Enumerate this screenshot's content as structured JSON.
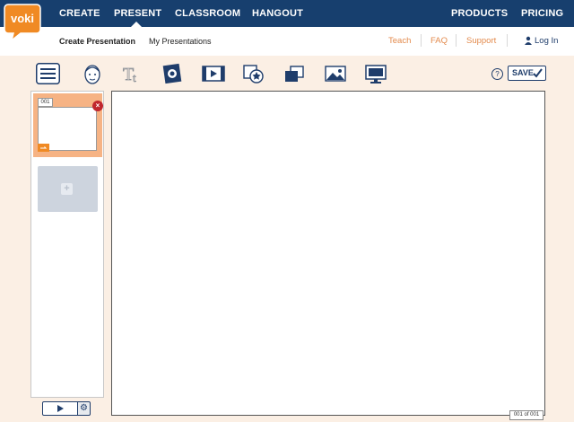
{
  "brand": {
    "logo_text": "voki",
    "logo_color": "#f08a24"
  },
  "topnav": {
    "items": [
      "CREATE",
      "PRESENT",
      "CLASSROOM",
      "HANGOUT"
    ],
    "active": "PRESENT",
    "right": [
      "PRODUCTS",
      "PRICING"
    ],
    "bg_color": "#173f6e"
  },
  "subnav": {
    "create_label": "Create Presentation",
    "my_label": "My Presentations",
    "teach": "Teach",
    "faq": "FAQ",
    "support": "Support",
    "login": "Log In"
  },
  "toolbar": {
    "icons": [
      "menu-icon",
      "character-icon",
      "text-icon",
      "image-icon",
      "video-icon",
      "shape-icon",
      "layers-icon",
      "background-icon",
      "screen-icon"
    ],
    "help": "?",
    "save": "SAVE"
  },
  "slides": {
    "items": [
      {
        "number": "001"
      }
    ],
    "add_label": "+"
  },
  "controls": {
    "settings_icon": "⚙"
  },
  "canvas": {
    "page_counter": "001 of 001"
  }
}
